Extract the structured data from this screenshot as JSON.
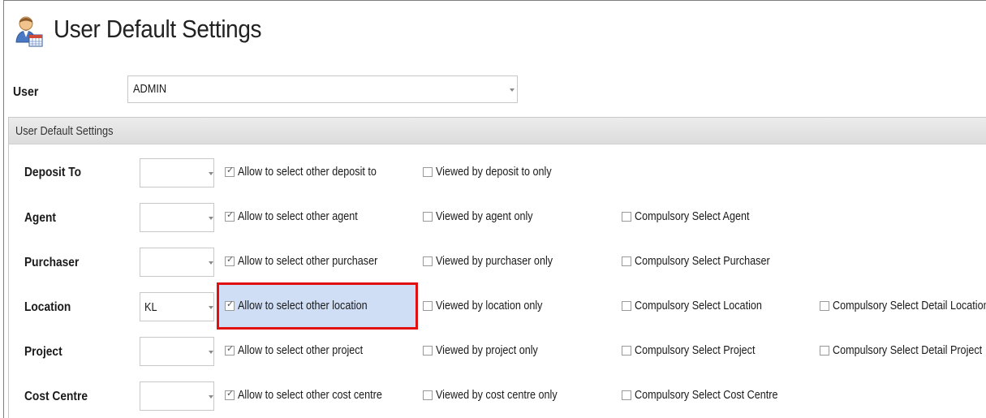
{
  "header": {
    "title": "User Default Settings",
    "icon": "user-settings-icon"
  },
  "user": {
    "label": "User",
    "value": "ADMIN"
  },
  "group": {
    "title": "User Default Settings"
  },
  "rows": [
    {
      "label": "Deposit To",
      "combo_value": "",
      "allow_label": "Allow to select other deposit to",
      "allow_checked": true,
      "viewed_label": "Viewed by deposit to only",
      "viewed_checked": false
    },
    {
      "label": "Agent",
      "combo_value": "",
      "allow_label": "Allow to select other agent",
      "allow_checked": true,
      "viewed_label": "Viewed by agent only",
      "viewed_checked": false,
      "compulsory_label": "Compulsory Select Agent",
      "compulsory_checked": false
    },
    {
      "label": "Purchaser",
      "combo_value": "",
      "allow_label": "Allow to select other purchaser",
      "allow_checked": true,
      "viewed_label": "Viewed by purchaser only",
      "viewed_checked": false,
      "compulsory_label": "Compulsory Select Purchaser",
      "compulsory_checked": false
    },
    {
      "label": "Location",
      "combo_value": "KL",
      "allow_label": "Allow to select other location",
      "allow_checked": true,
      "viewed_label": "Viewed by location only",
      "viewed_checked": false,
      "compulsory_label": "Compulsory Select Location",
      "compulsory_checked": false,
      "detail_label": "Compulsory Select Detail Location",
      "detail_checked": false
    },
    {
      "label": "Project",
      "combo_value": "",
      "allow_label": "Allow to select other project",
      "allow_checked": true,
      "viewed_label": "Viewed by project only",
      "viewed_checked": false,
      "compulsory_label": "Compulsory Select Project",
      "compulsory_checked": false,
      "detail_label": "Compulsory Select Detail Project",
      "detail_checked": false
    },
    {
      "label": "Cost Centre",
      "combo_value": "",
      "allow_label": "Allow to select other cost centre",
      "allow_checked": true,
      "viewed_label": "Viewed by cost centre only",
      "viewed_checked": false,
      "compulsory_label": "Compulsory Select Cost Centre",
      "compulsory_checked": false
    }
  ],
  "colors": {
    "highlight": "#cfddf5",
    "annotation_border": "#e01010"
  }
}
